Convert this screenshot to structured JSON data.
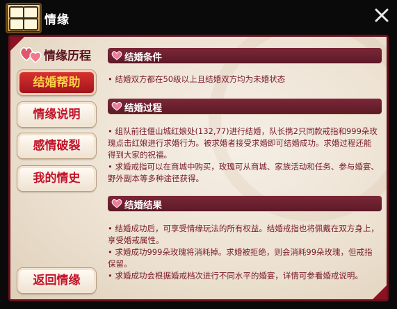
{
  "window": {
    "title": "情缘",
    "close_icon": "close-x-icon",
    "logo_icon": "game-logo-icon"
  },
  "colors": {
    "frame": "#6e0f1d",
    "header": "#6b2030",
    "button_text": "#c2132a",
    "active_button_bg": "#b81d22",
    "active_button_text": "#ffd04a",
    "body_text": "#7a1a2a"
  },
  "sidebar": {
    "heading": "情缘历程",
    "items": [
      {
        "label": "结婚帮助",
        "active": true
      },
      {
        "label": "情缘说明",
        "active": false
      },
      {
        "label": "感情破裂",
        "active": false
      },
      {
        "label": "我的情史",
        "active": false
      }
    ],
    "back_label": "返回情缘"
  },
  "sections": [
    {
      "title": "结婚条件",
      "lines": [
        "• 结婚双方都在50级以上且结婚双方均为未婚状态"
      ]
    },
    {
      "title": "结婚过程",
      "lines": [
        "• 组队前往偃山城红娘处(132,77)进行结婚，队长携2只同款戒指和999朵玫瑰点击红娘进行求婚行为。被求婚者接受求婚即可结婚成功。求婚过程还能得到大家的祝福。",
        "• 求婚戒指可以在商城中购买，玫瑰可从商城、家族活动和任务、参与婚宴、野外副本等多种途径获得。"
      ]
    },
    {
      "title": "结婚结果",
      "lines": [
        "• 结婚成功后，可享受情缘玩法的所有权益。结婚戒指也将佩戴在双方身上，享受婚戒属性。",
        "• 求婚成功999朵玫瑰将消耗掉。求婚被拒绝，则会消耗99朵玫瑰，但戒指保留。",
        "• 求婚成功会根据婚戒档次进行不同水平的婚宴，详情可参看婚戒说明。"
      ]
    }
  ]
}
